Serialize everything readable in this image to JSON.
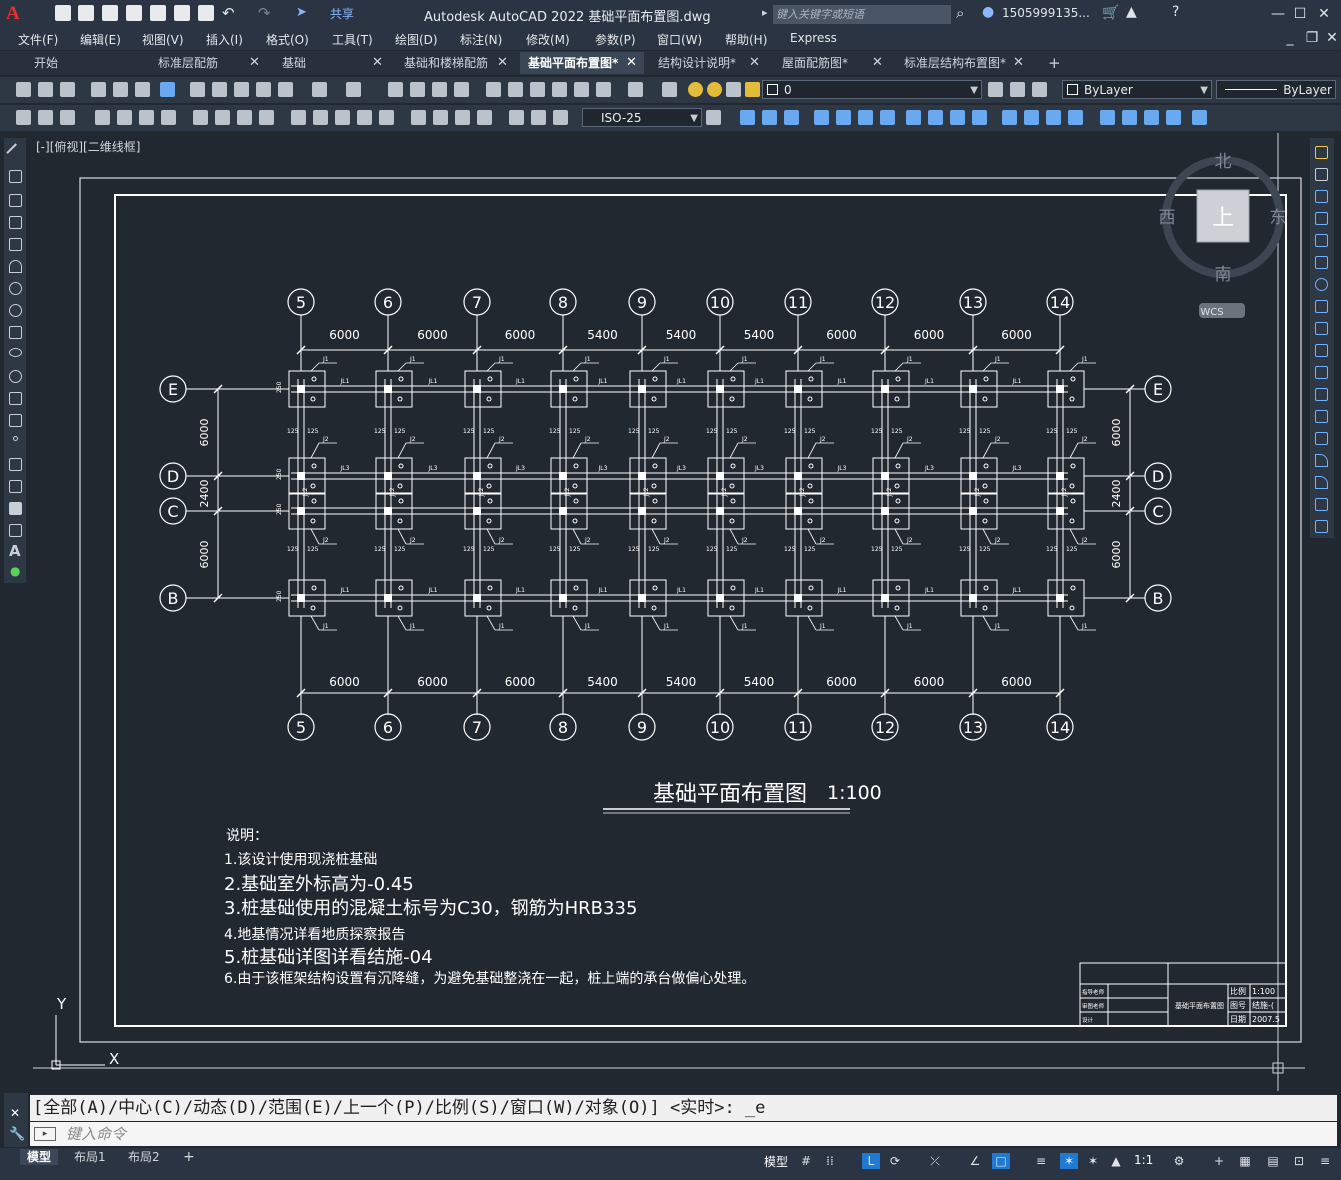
{
  "app": {
    "share_label": "共享",
    "title": "Autodesk AutoCAD 2022    基础平面布置图.dwg",
    "search_placeholder": "键入关键字或短语",
    "user": "1505999135...",
    "logo": "A"
  },
  "menus": [
    "文件(F)",
    "编辑(E)",
    "视图(V)",
    "插入(I)",
    "格式(O)",
    "工具(T)",
    "绘图(D)",
    "标注(N)",
    "修改(M)",
    "参数(P)",
    "窗口(W)",
    "帮助(H)",
    "Express"
  ],
  "file_tabs": [
    {
      "label": "开始",
      "active": false
    },
    {
      "label": "标准层配筋",
      "active": false
    },
    {
      "label": "基础",
      "active": false
    },
    {
      "label": "基础和楼梯配筋",
      "active": false
    },
    {
      "label": "基础平面布置图*",
      "active": true
    },
    {
      "label": "结构设计说明*",
      "active": false
    },
    {
      "label": "屋面配筋图*",
      "active": false
    },
    {
      "label": "标准层结构布置图*",
      "active": false
    }
  ],
  "toolbar": {
    "layer_value": "0",
    "color_value": "ByLayer",
    "linetype_value": "ByLayer",
    "dimstyle_value": "ISO-25"
  },
  "viewport_label": "[-][俯视][二维线框]",
  "viewcube": {
    "north": "北",
    "south": "南",
    "west": "西",
    "east": "东",
    "face": "上",
    "wcs": "WCS"
  },
  "drawing": {
    "axes_top": [
      "5",
      "6",
      "7",
      "8",
      "9",
      "10",
      "11",
      "12",
      "13",
      "14"
    ],
    "spans": [
      "6000",
      "6000",
      "6000",
      "5400",
      "5400",
      "5400",
      "6000",
      "6000",
      "6000"
    ],
    "axes_side": [
      "E",
      "D",
      "C",
      "B"
    ],
    "side_spans": [
      "6000",
      "2400",
      "6000"
    ],
    "beam_labels": {
      "jl1": "JL1",
      "jl2": "JL2",
      "jl3": "JL3",
      "j1": "J1",
      "j2": "J2",
      "dim125": "125",
      "dim250": "250"
    },
    "title": "基础平面布置图",
    "scale": "1:100",
    "notes": [
      "说明：",
      "1.该设计使用现浇桩基础",
      "2.基础室外标高为-0.45",
      "3.桩基础使用的混凝土标号为C30，钢筋为HRB335",
      "4.地基情况详看地质探察报告",
      "5.桩基础详图详看结施-04",
      "6.由于该框架结构设置有沉降缝，为避免基础整浇在一起，桩上端的承台做偏心处理。"
    ],
    "titleblock": {
      "rows_left": [
        "指导老师",
        "审图老师",
        "设计"
      ],
      "name": "基础平面布置图",
      "k1": "比例",
      "v1": "1:100",
      "k2": "图号",
      "v2": "结施-(",
      "k3": "日期",
      "v3": "2007.5"
    },
    "ucs_y": "Y",
    "ucs_x": "X"
  },
  "command": {
    "history": "[全部(A)/中心(C)/动态(D)/范围(E)/上一个(P)/比例(S)/窗口(W)/对象(O)] <实时>: _e",
    "placeholder": "键入命令"
  },
  "layout_tabs": [
    "模型",
    "布局1",
    "布局2"
  ],
  "status": {
    "model": "模型",
    "scale": "1:1"
  },
  "colors": {
    "background": "#212830",
    "panel": "#2e3744",
    "accent": "#6fb3ff",
    "logo": "#e8302c"
  }
}
